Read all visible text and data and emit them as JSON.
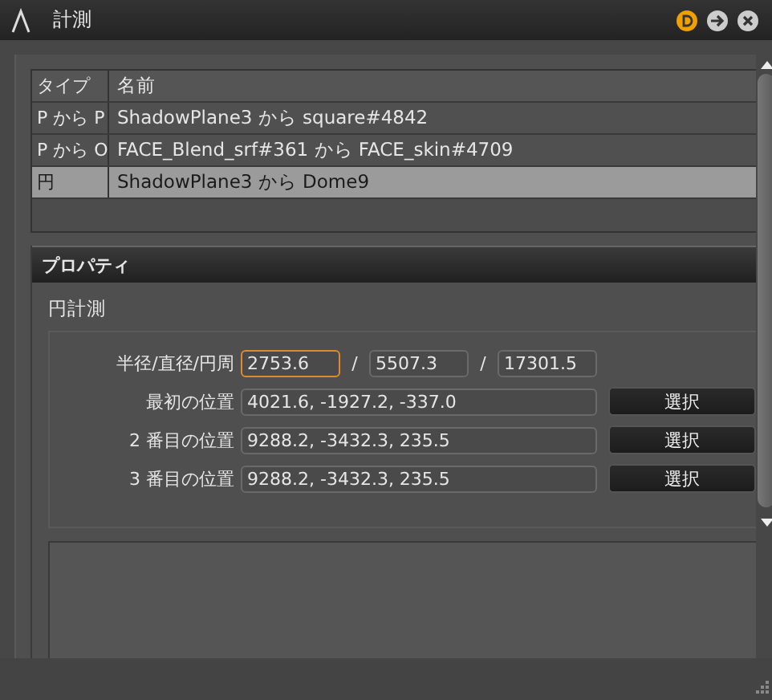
{
  "window": {
    "title": "計測"
  },
  "table": {
    "columns": [
      "タイプ",
      "名前"
    ],
    "rows": [
      {
        "type": "P から P",
        "name": "ShadowPlane3 から square#4842",
        "selected": false
      },
      {
        "type": "P から O",
        "name": "FACE_Blend_srf#361 から  FACE_skin#4709",
        "selected": false
      },
      {
        "type": "円",
        "name": "ShadowPlane3 から Dome9",
        "selected": true
      }
    ]
  },
  "properties": {
    "header": "プロパティ",
    "section": "円計測",
    "size_row": {
      "label": "半径/直径/円周",
      "fields": [
        {
          "value": "2753.6",
          "focused": true
        },
        {
          "value": "5507.3",
          "focused": false
        },
        {
          "value": "17301.5",
          "focused": false
        }
      ],
      "separators": [
        "/",
        "/"
      ]
    },
    "positions": [
      {
        "label": "最初の位置",
        "value": "4021.6, -1927.2, -337.0",
        "button": "選択"
      },
      {
        "label": "2 番目の位置",
        "value": "9288.2, -3432.3, 235.5",
        "button": "選択"
      },
      {
        "label": "3 番目の位置",
        "value": "9288.2, -3432.3, 235.5",
        "button": "選択"
      }
    ]
  }
}
